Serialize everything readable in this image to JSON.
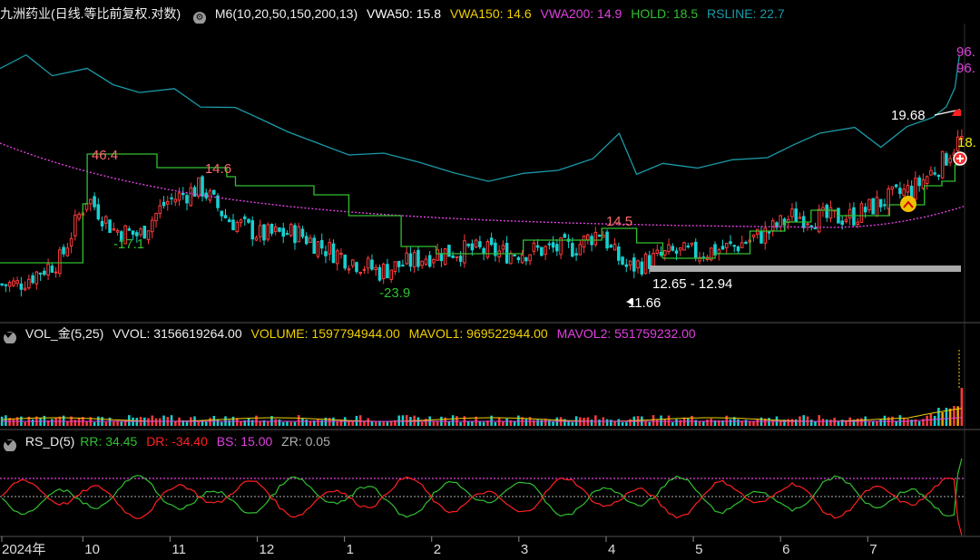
{
  "colors": {
    "price_up": "#ff3b3b",
    "price_down": "#18d0d0",
    "vwa50": "#ffffff",
    "vwa150": "#f0d000",
    "vwa200": "#e040e0",
    "hold": "#30c030",
    "rsline": "#1a9aa8",
    "rr": "#30c030",
    "dr": "#ff2020",
    "bs": "#e040e0",
    "zr": "#b0b0b0",
    "mavol1": "#f0d000",
    "mavol2": "#e040e0"
  },
  "header": {
    "title": "九洲药业(日线.等比前复权.对数)",
    "indicator_name": "M6(10,20,50,150,200,13)",
    "vwa50": "VWA50: 15.8",
    "vwa150": "VWA150: 14.6",
    "vwa200": "VWA200: 14.9",
    "hold": "HOLD: 18.5",
    "rsline": "RSLINE: 22.7"
  },
  "vol_header": {
    "name": "VOL_金(5,25)",
    "vvol": "VVOL: 3156619264.00",
    "volume": "VOLUME: 1597794944.00",
    "mavol1": "MAVOL1: 969522944.00",
    "mavol2": "MAVOL2: 551759232.00"
  },
  "rs_header": {
    "name": "RS_D(5)",
    "rr": "RR: 34.45",
    "dr": "DR: -34.40",
    "bs": "BS: 15.00",
    "zr": "ZR: 0.05"
  },
  "chart_data": {
    "type": "line",
    "x_axis_labels": [
      "2024年",
      "10",
      "11",
      "12",
      "1",
      "2",
      "3",
      "4",
      "5",
      "6",
      "7"
    ],
    "price_annotations": [
      "46.4",
      "14.6",
      "-17.1",
      "-23.9",
      "14.5",
      "12.65 - 12.94",
      "11.66",
      "19.68",
      "18.",
      "96.",
      "96."
    ],
    "price_points": [
      {
        "month": 9.2,
        "price": 11.2
      },
      {
        "month": 9.7,
        "price": 12.0
      },
      {
        "month": 10.0,
        "price": 14.2
      },
      {
        "month": 10.3,
        "price": 13.0
      },
      {
        "month": 10.6,
        "price": 12.8
      },
      {
        "month": 10.9,
        "price": 14.0
      },
      {
        "month": 11.3,
        "price": 14.6
      },
      {
        "month": 11.6,
        "price": 13.4
      },
      {
        "month": 12.0,
        "price": 12.8
      },
      {
        "month": 12.4,
        "price": 12.9
      },
      {
        "month": 12.7,
        "price": 12.4
      },
      {
        "month": 13.0,
        "price": 12.0
      },
      {
        "month": 13.35,
        "price": 11.6
      },
      {
        "month": 13.7,
        "price": 11.9
      },
      {
        "month": 14.0,
        "price": 12.2
      },
      {
        "month": 14.4,
        "price": 12.3
      },
      {
        "month": 14.8,
        "price": 12.2
      },
      {
        "month": 15.2,
        "price": 12.3
      },
      {
        "month": 15.6,
        "price": 12.4
      },
      {
        "month": 15.9,
        "price": 13.0
      },
      {
        "month": 16.0,
        "price": 12.3
      },
      {
        "month": 16.2,
        "price": 11.7
      },
      {
        "month": 16.4,
        "price": 11.9
      },
      {
        "month": 16.7,
        "price": 12.2
      },
      {
        "month": 17.0,
        "price": 12.2
      },
      {
        "month": 17.4,
        "price": 12.4
      },
      {
        "month": 17.8,
        "price": 12.9
      },
      {
        "month": 18.1,
        "price": 13.5
      },
      {
        "month": 18.5,
        "price": 13.4
      },
      {
        "month": 18.8,
        "price": 13.5
      },
      {
        "month": 19.1,
        "price": 14.0
      },
      {
        "month": 19.5,
        "price": 14.6
      },
      {
        "month": 19.8,
        "price": 15.6
      },
      {
        "month": 20.0,
        "price": 16.6
      }
    ],
    "series": [
      {
        "name": "RSLINE"
      },
      {
        "name": "VWA200"
      },
      {
        "name": "HOLD"
      },
      {
        "name": "VOLUME"
      },
      {
        "name": "MAVOL1"
      },
      {
        "name": "MAVOL2"
      },
      {
        "name": "RR"
      },
      {
        "name": "DR"
      },
      {
        "name": "BS"
      },
      {
        "name": "ZR"
      }
    ],
    "grid": false,
    "legend": "top-left"
  }
}
